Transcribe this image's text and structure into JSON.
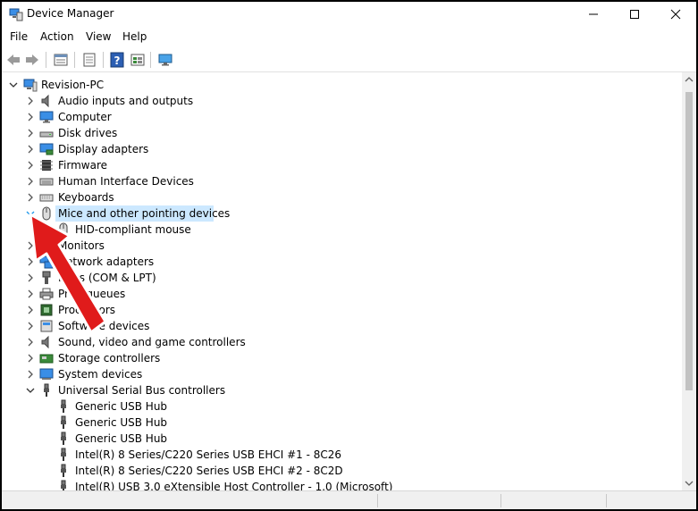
{
  "window": {
    "title": "Device Manager",
    "icon": "device-manager-icon"
  },
  "menu": [
    "File",
    "Action",
    "View",
    "Help"
  ],
  "toolbar": [
    "back-icon",
    "forward-icon",
    "properties-icon",
    "update-driver-icon",
    "help-icon",
    "view-icon",
    "monitor-icon"
  ],
  "tree": {
    "root": "Revision-PC",
    "categories": [
      "Audio inputs and outputs",
      "Computer",
      "Disk drives",
      "Display adapters",
      "Firmware",
      "Human Interface Devices",
      "Keyboards",
      "Mice and other pointing devices",
      "HID-compliant mouse",
      "Monitors",
      "Network adapters",
      "Ports (COM & LPT)",
      "Print queues",
      "Processors",
      "Software devices",
      "Sound, video and game controllers",
      "Storage controllers",
      "System devices",
      "Universal Serial Bus controllers",
      "Generic USB Hub",
      "Generic USB Hub",
      "Generic USB Hub",
      "Intel(R) 8 Series/C220 Series USB EHCI #1 - 8C26",
      "Intel(R) 8 Series/C220 Series USB EHCI #2 - 8C2D",
      "Intel(R) USB 3.0 eXtensible Host Controller - 1.0 (Microsoft)"
    ]
  },
  "colors": {
    "selection": "#cce8ff",
    "accent": "#0078d7",
    "annotation_arrow": "#e01b1b"
  }
}
